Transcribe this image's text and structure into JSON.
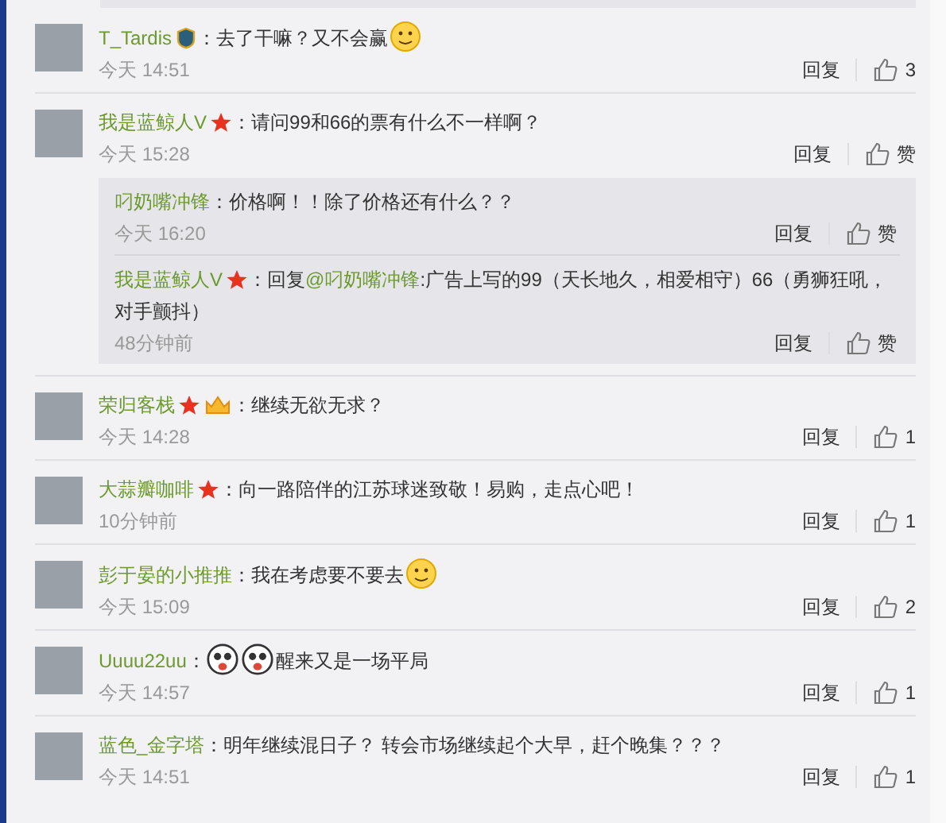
{
  "comments": [
    {
      "user": "T_Tardis",
      "badges": [
        {
          "kind": "game-badge"
        }
      ],
      "segments": [
        {
          "kind": "text",
          "text": "：去了干嘛？又不会赢"
        },
        {
          "kind": "emoji"
        }
      ],
      "time": "今天 14:51",
      "reply": "回复",
      "likes": "3"
    },
    {
      "user": "我是蓝鲸人V",
      "badges": [
        {
          "kind": "star"
        }
      ],
      "segments": [
        {
          "kind": "text",
          "text": "：请问99和66的票有什么不一样啊？"
        }
      ],
      "time": "今天 15:28",
      "reply": "回复",
      "likes": "赞",
      "replies": [
        {
          "user": "叼奶嘴冲锋",
          "segments": [
            {
              "kind": "text",
              "text": "：价格啊！！除了价格还有什么？？"
            }
          ],
          "time": "今天 16:20",
          "reply": "回复",
          "likes": "赞"
        },
        {
          "user": "我是蓝鲸人V",
          "badges": [
            {
              "kind": "star"
            }
          ],
          "segments": [
            {
              "kind": "text",
              "text": "：回复"
            },
            {
              "kind": "mention",
              "text": "@叼奶嘴冲锋"
            },
            {
              "kind": "text",
              "text": ":广告上写的99（天长地久，相爱相守）66（勇狮狂吼，对手颤抖）"
            }
          ],
          "time": "48分钟前",
          "reply": "回复",
          "likes": "赞"
        }
      ]
    },
    {
      "user": "荣归客栈",
      "badges": [
        {
          "kind": "star"
        },
        {
          "kind": "vip-badge"
        }
      ],
      "segments": [
        {
          "kind": "text",
          "text": "：继续无欲无求？"
        }
      ],
      "time": "今天 14:28",
      "reply": "回复",
      "likes": "1"
    },
    {
      "user": "大蒜瓣咖啡",
      "badges": [
        {
          "kind": "star"
        }
      ],
      "segments": [
        {
          "kind": "text",
          "text": "：向一路陪伴的江苏球迷致敬！易购，走点心吧！"
        }
      ],
      "time": "10分钟前",
      "reply": "回复",
      "likes": "1"
    },
    {
      "user": "彭于晏的小推推",
      "segments": [
        {
          "kind": "text",
          "text": "：我在考虑要不要去"
        },
        {
          "kind": "emoji"
        }
      ],
      "time": "今天 15:09",
      "reply": "回复",
      "likes": "2"
    },
    {
      "user": "Uuuu22uu",
      "segments": [
        {
          "kind": "text",
          "text": "："
        },
        {
          "kind": "face-emoji"
        },
        {
          "kind": "face-emoji"
        },
        {
          "kind": "text",
          "text": "醒来又是一场平局"
        }
      ],
      "time": "今天 14:57",
      "reply": "回复",
      "likes": "1"
    },
    {
      "user": "蓝色_金字塔",
      "segments": [
        {
          "kind": "text",
          "text": "：明年继续混日子？ 转会市场继续起个大早，赶个晚集？？？"
        }
      ],
      "time": "今天 14:51",
      "reply": "回复",
      "likes": "1"
    }
  ]
}
